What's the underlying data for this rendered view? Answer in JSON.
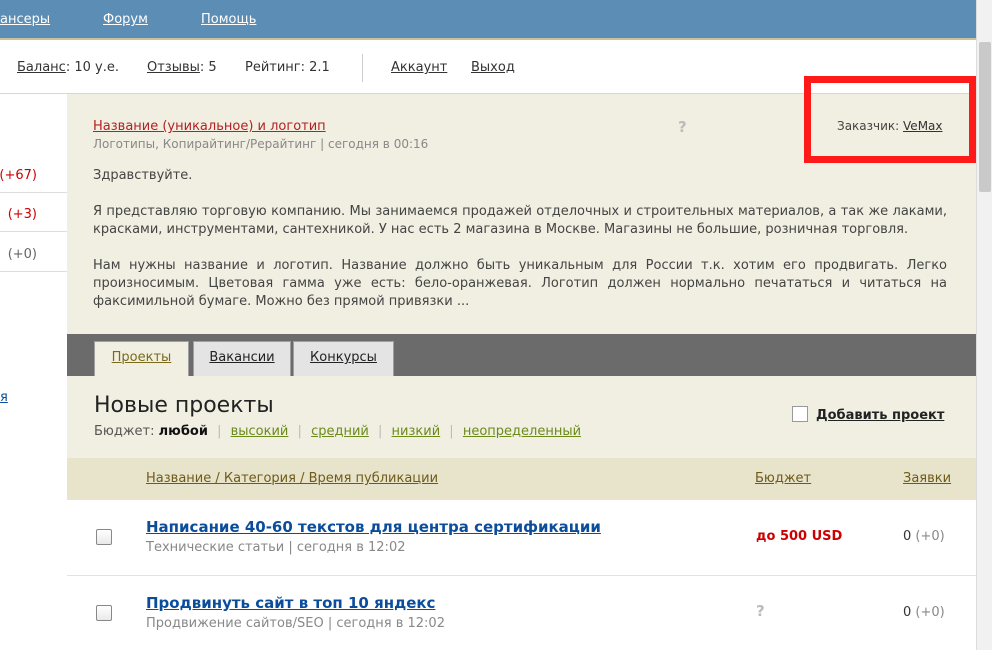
{
  "topnav": {
    "freelancers": "ансеры",
    "forum": "Форум",
    "help": "Помощь"
  },
  "userbar": {
    "balance_label": "Баланс",
    "balance_value": ": 10 у.е.",
    "reviews_label": "Отзывы",
    "reviews_value": ": 5",
    "rating": "Рейтинг: 2.1",
    "account": "Аккаунт",
    "logout": "Выход"
  },
  "leftcol": {
    "items": [
      "(+67)",
      "(+3)",
      "(+0)"
    ],
    "link": "я"
  },
  "featured": {
    "title": "Название (уникальное) и логотип",
    "meta": "Логотипы, Копирайтинг/Рерайтинг | сегодня в 00:16",
    "customer_label": "Заказчик: ",
    "customer_name": "VeMax",
    "q": "?",
    "greeting": "Здравствуйте.",
    "para1": "Я представляю торговую компанию. Мы занимаемся продажей отделочных и строительных материалов, а так же лаками, красками, инструментами, сантехникой. У нас есть 2 магазина в Москве. Магазины не большие, розничная торговля.",
    "para2": "Нам нужны название и логотип. Название должно быть уникальным для России т.к. хотим его продвигать. Легко произносимым. Цветовая гамма уже есть: бело-оранжевая. Логотип должен нормально печататься и читаться на факсимильной бумаге. Можно без прямой привязки ..."
  },
  "tabs": [
    "Проекты",
    "Вакансии",
    "Конкурсы"
  ],
  "list": {
    "title": "Новые проекты",
    "budget_label": "Бюджет:",
    "budget_current": "любой",
    "budget_options": [
      "высокий",
      "средний",
      "низкий",
      "неопределенный"
    ],
    "add_project": "Добавить проект"
  },
  "columns": {
    "name": "Название / Категория / Время публикации",
    "budget": "Бюджет",
    "bids": "Заявки"
  },
  "projects": [
    {
      "title": "Написание 40-60 текстов для центра сертификации",
      "meta": "Технические статьи | сегодня в 12:02",
      "price": "до 500 USD",
      "bids": "0",
      "bids_extra": "(+0)"
    },
    {
      "title": "Продвинуть сайт в топ 10 яндекс",
      "meta": "Продвижение сайтов/SEO | сегодня в 12:02",
      "price": "?",
      "bids": "0",
      "bids_extra": "(+0)"
    }
  ],
  "colors": {
    "topbar": "#5b8db5",
    "feature_bg": "#f1efe2",
    "highlight": "#ff1a1a",
    "project_link": "#0b4d9b",
    "price": "#cc0000"
  }
}
